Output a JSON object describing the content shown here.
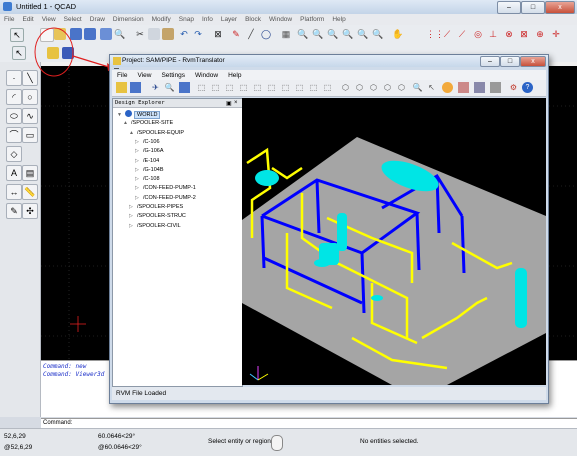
{
  "qcad": {
    "title": "Untitled 1 - QCAD",
    "menu": [
      "File",
      "Edit",
      "View",
      "Select",
      "Draw",
      "Dimension",
      "Modify",
      "Snap",
      "Info",
      "Layer",
      "Block",
      "Window",
      "Platform",
      "Help"
    ],
    "window_controls": {
      "minimize": "–",
      "maximize": "□",
      "close": "x"
    },
    "command_history": [
      "Command: new",
      "Command: Viewer3d"
    ],
    "command_prompt": "Command:",
    "status": {
      "coord_abs": "52,6,29",
      "coord_rel": "@52,6,29",
      "coord_polar": "60.0646<29°",
      "coord_polar_rel": "@60.0646<29°",
      "hint": "Select entity or region",
      "selection": "No entities selected."
    }
  },
  "rvm": {
    "title": "Project: SAM/PIPE - RvmTranslator",
    "menu": [
      "File",
      "View",
      "Settings",
      "Window",
      "Help"
    ],
    "explorer_title": "Design Explorer",
    "tree": [
      {
        "label": "WORLD",
        "level": 0,
        "expander": "▼",
        "selected": true
      },
      {
        "label": "/SPOOLER-SITE",
        "level": 1,
        "expander": "▲"
      },
      {
        "label": "/SPOOLER-EQUIP",
        "level": 2,
        "expander": "▲"
      },
      {
        "label": "/C-106",
        "level": 3,
        "expander": "▷"
      },
      {
        "label": "/G-106A",
        "level": 3,
        "expander": "▷"
      },
      {
        "label": "/E-104",
        "level": 3,
        "expander": "▷"
      },
      {
        "label": "/G-104B",
        "level": 3,
        "expander": "▷"
      },
      {
        "label": "/C-108",
        "level": 3,
        "expander": "▷"
      },
      {
        "label": "/CON-FEED-PUMP-1",
        "level": 3,
        "expander": "▷"
      },
      {
        "label": "/CON-FEED-PUMP-2",
        "level": 3,
        "expander": "▷"
      },
      {
        "label": "/SPOOLER-PIPES",
        "level": 2,
        "expander": "▷"
      },
      {
        "label": "/SPOOLER-STRUC",
        "level": 2,
        "expander": "▷"
      },
      {
        "label": "/SPOOLER-CIVIL",
        "level": 2,
        "expander": "▷"
      }
    ],
    "status": "RVM File Loaded"
  },
  "colors": {
    "pipe": "#ffff00",
    "structure": "#0000ff",
    "equipment": "#00e5e5",
    "floor": "#a5a5a5",
    "annotation": "#e02020"
  }
}
